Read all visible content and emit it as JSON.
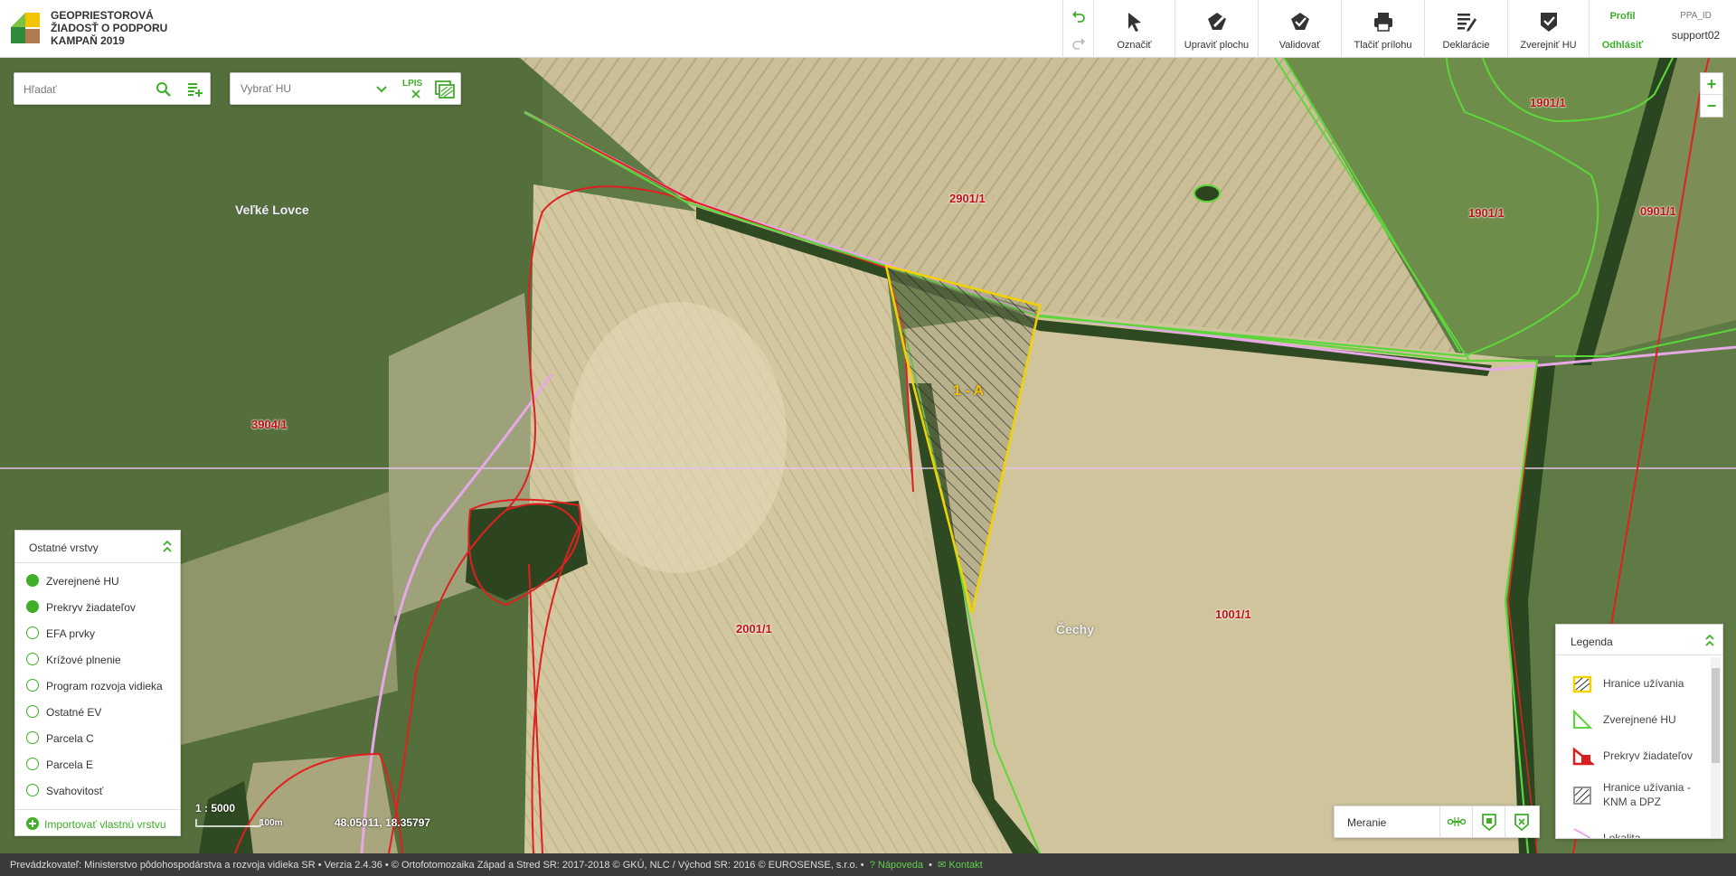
{
  "header": {
    "title_lines": [
      "GEOPRIESTOROVÁ",
      "ŽIADOSŤ O PODPORU",
      "KAMPAŇ 2019"
    ],
    "tools": [
      {
        "label": "Označiť",
        "icon": "cursor-icon"
      },
      {
        "label": "Upraviť plochu",
        "icon": "edit-area-icon"
      },
      {
        "label": "Validovať",
        "icon": "validate-icon"
      },
      {
        "label": "Tlačiť prílohu",
        "icon": "print-icon"
      },
      {
        "label": "Deklarácie",
        "icon": "declaration-icon"
      },
      {
        "label": "Zverejniť HU",
        "icon": "publish-icon"
      }
    ],
    "profile_label": "Profil",
    "logout_label": "Odhlásiť",
    "ppa_label": "PPA_ID",
    "username": "support02"
  },
  "search": {
    "placeholder": "Hľadať"
  },
  "hu_select": {
    "placeholder": "Vybrať HU",
    "lpis_label": "LPIS"
  },
  "zoom": {
    "in": "+",
    "out": "−"
  },
  "map": {
    "parcel_labels": [
      "2901/1",
      "1901/1",
      "1901/1",
      "0901/1",
      "3904/1",
      "2001/1",
      "1001/1"
    ],
    "place_labels": [
      "Veľké Lovce",
      "Čechy"
    ],
    "hu_label": "1 - A"
  },
  "layers": {
    "title": "Ostatné vrstvy",
    "items": [
      {
        "label": "Zverejnené HU",
        "checked": true
      },
      {
        "label": "Prekryv žiadateľov",
        "checked": true
      },
      {
        "label": "EFA prvky",
        "checked": false
      },
      {
        "label": "Krížové plnenie",
        "checked": false
      },
      {
        "label": "Program rozvoja vidieka",
        "checked": false
      },
      {
        "label": "Ostatné EV",
        "checked": false
      },
      {
        "label": "Parcela C",
        "checked": false
      },
      {
        "label": "Parcela E",
        "checked": false
      },
      {
        "label": "Svahovitosť",
        "checked": false
      }
    ],
    "import_label": "Importovať vlastnú vrstvu"
  },
  "scale": {
    "ratio": "1 : 5000",
    "length": "100m",
    "coords": "48.05011, 18.35797"
  },
  "measure": {
    "label": "Meranie"
  },
  "legend": {
    "title": "Legenda",
    "items": [
      {
        "label": "Hranice užívania",
        "color": "#f2d200"
      },
      {
        "label": "Zverejnené HU",
        "color": "#5cd63a"
      },
      {
        "label": "Prekryv žiadateľov",
        "color": "#d81e1e"
      },
      {
        "label": "Hranice užívania - KNM a DPZ",
        "color": "#555555"
      },
      {
        "label": "Lokalita",
        "color": "#e8a8e8"
      }
    ]
  },
  "footer": {
    "text": "Prevádzkovateľ: Ministerstvo pôdohospodárstva a rozvoja vidieka SR • Verzia 2.4.36 • © Ortofotomozaika Západ a Stred SR: 2017-2018 © GKÚ, NLC / Východ SR: 2016 © EUROSENSE, s.r.o. •",
    "help": "Nápoveda",
    "contact": "Kontakt"
  },
  "colors": {
    "accent": "#3fae29",
    "parcel_border": "#e02020",
    "hu_border": "#f2d200",
    "published": "#5cd63a"
  }
}
